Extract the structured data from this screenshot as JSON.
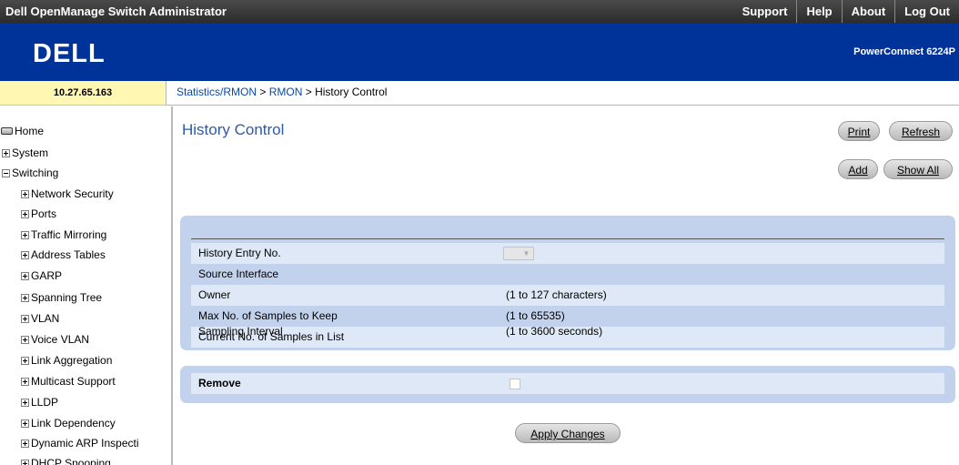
{
  "app": {
    "title": "Dell OpenManage Switch Administrator",
    "links": [
      "Support",
      "Help",
      "About",
      "Log Out"
    ]
  },
  "header": {
    "logo_text": "DELL",
    "product": "PowerConnect 6224P",
    "bg_color": "#00339a"
  },
  "device": {
    "ip": "10.27.65.163"
  },
  "breadcrumb": {
    "items": [
      "Statistics/RMON",
      "RMON",
      "History Control"
    ],
    "separator": ">"
  },
  "nav": {
    "home": "Home",
    "system": "System",
    "switching": "Switching",
    "children": [
      "Network Security",
      "Ports",
      "Traffic Mirroring",
      "Address Tables",
      "GARP",
      "Spanning Tree",
      "VLAN",
      "Voice VLAN",
      "Link Aggregation",
      "Multicast Support",
      "LLDP",
      "Link Dependency",
      "Dynamic ARP Inspecti",
      "DHCP Snooping"
    ]
  },
  "page": {
    "title": "History Control",
    "buttons": {
      "print": "Print",
      "refresh": "Refresh",
      "add": "Add",
      "show_all": "Show All",
      "apply": "Apply Changes"
    }
  },
  "form": {
    "rows": [
      {
        "label": "History Entry No.",
        "value": ""
      },
      {
        "label": "Source Interface",
        "value": ""
      },
      {
        "label": "Owner",
        "value": "(1 to 127 characters)"
      },
      {
        "label": "Max No. of Samples to Keep",
        "value": "(1 to 65535)"
      },
      {
        "label": "Current No. of Samples in List",
        "value": ""
      },
      {
        "label": "Sampling Interval",
        "value": "(1 to 3600 seconds)"
      }
    ],
    "remove_label": "Remove"
  },
  "colors": {
    "panel": "#c3d2ec",
    "row_alt": "#dfe8f7",
    "title": "#2f5aa6",
    "ip_bg": "#fff7b2"
  }
}
